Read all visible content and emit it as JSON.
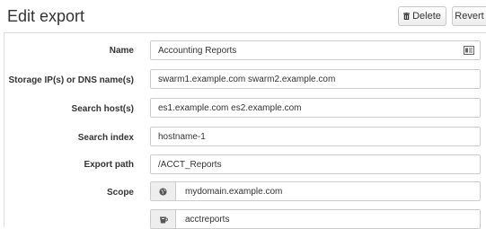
{
  "header": {
    "title": "Edit export",
    "delete_label": "Delete",
    "revert_label": "Revert"
  },
  "form": {
    "name": {
      "label": "Name",
      "value": "Accounting Reports"
    },
    "storage": {
      "label": "Storage IP(s) or DNS name(s)",
      "value": "swarm1.example.com swarm2.example.com"
    },
    "search_hosts": {
      "label": "Search host(s)",
      "value": "es1.example.com es2.example.com"
    },
    "search_index": {
      "label": "Search index",
      "value": "hostname-1"
    },
    "export_path": {
      "label": "Export path",
      "value": "/ACCT_Reports"
    },
    "scope": {
      "label": "Scope",
      "domain": "mydomain.example.com",
      "bucket": "acctreports"
    }
  },
  "icons": {
    "delete": "trash-icon",
    "name_field": "id-card-icon",
    "domain": "globe-icon",
    "bucket": "bucket-icon"
  }
}
